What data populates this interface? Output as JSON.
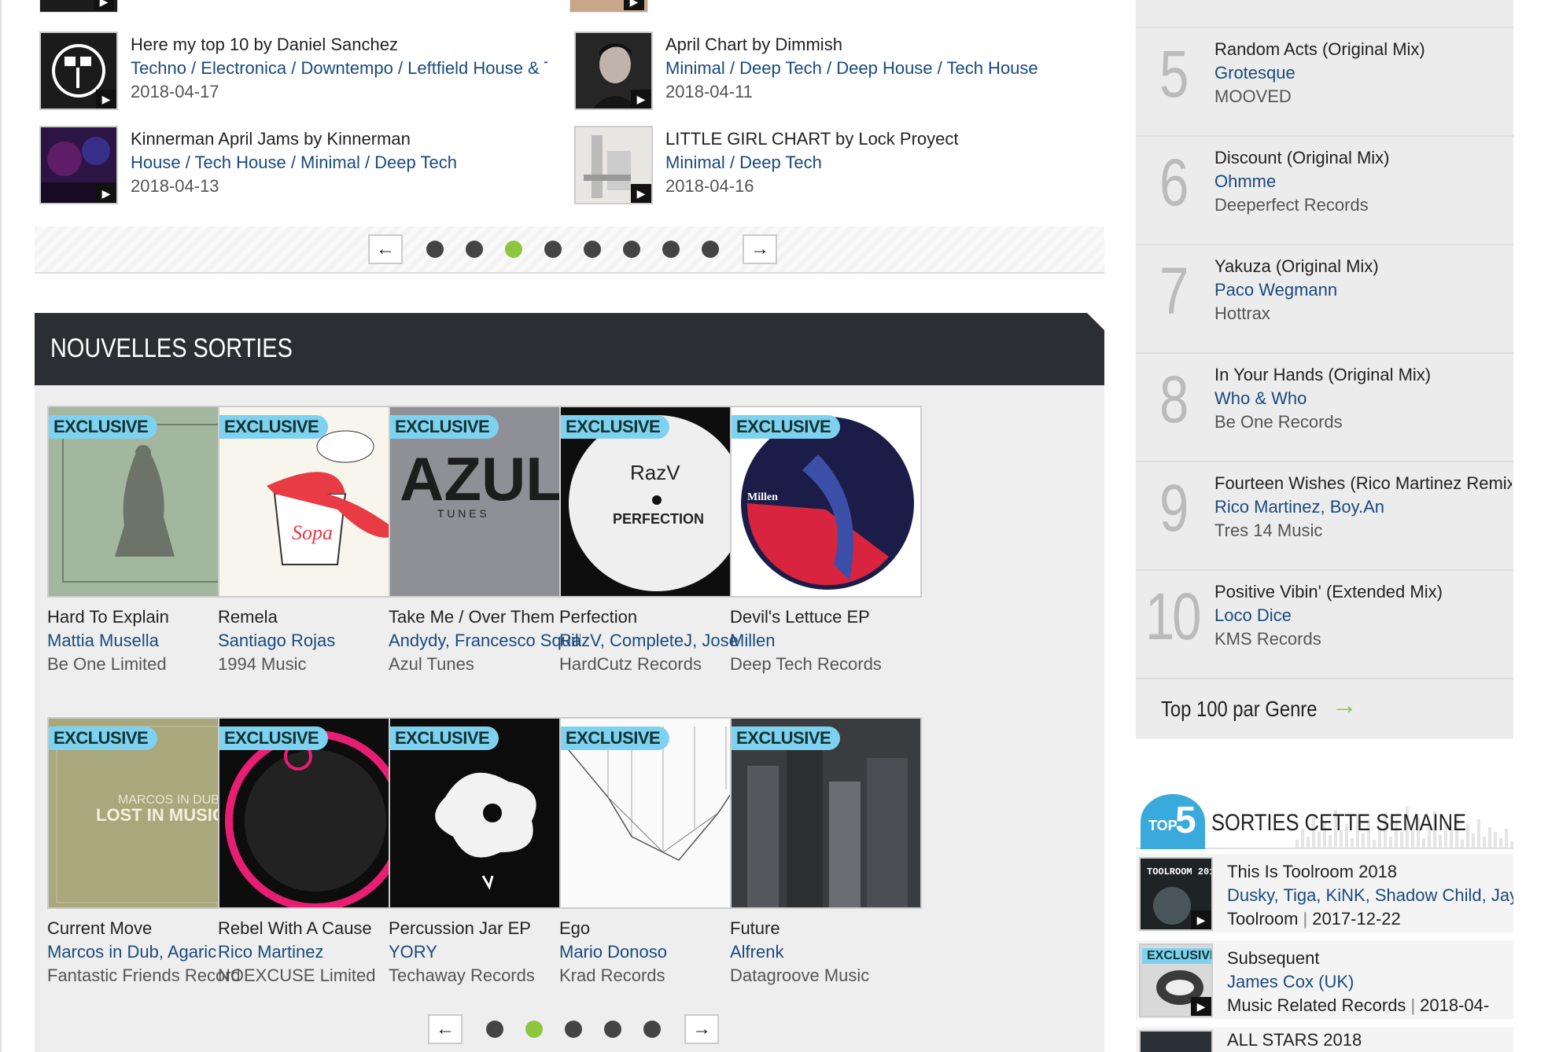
{
  "charts": [
    {
      "title": "Here my top 10 by Daniel Sanchez",
      "genres": "Techno / Electronica / Downtempo / Leftfield House & Techno",
      "date": "2018-04-17"
    },
    {
      "title": "April Chart by Dimmish",
      "genres": "Minimal / Deep Tech / Deep House / Tech House",
      "date": "2018-04-11"
    },
    {
      "title": "Kinnerman April Jams by Kinnerman",
      "genres": "House / Tech House / Minimal / Deep Tech",
      "date": "2018-04-13"
    },
    {
      "title": "LITTLE GIRL CHART by Lock Proyect",
      "genres": "Minimal / Deep Tech",
      "date": "2018-04-16"
    }
  ],
  "charts_pager": {
    "prev": "←",
    "next": "→",
    "pages": 8,
    "active": 3
  },
  "new_releases": {
    "heading": "NOUVELLES SORTIES",
    "badge": "EXCLUSIVE",
    "items": [
      {
        "title": "Hard To Explain",
        "artist": "Mattia Musella",
        "label": "Be One Limited"
      },
      {
        "title": "Remela",
        "artist": "Santiago Rojas",
        "label": "1994 Music"
      },
      {
        "title": "Take Me / Over Them",
        "artist": "Andydy, Francesco Squillante",
        "label": "Azul Tunes"
      },
      {
        "title": "Perfection",
        "artist": "RazV, CompleteJ, Jose",
        "label": "HardCutz Records"
      },
      {
        "title": "Devil's Lettuce EP",
        "artist": "Millen",
        "label": "Deep Tech Records"
      },
      {
        "title": "Current Move",
        "artist": "Marcos in Dub, Agaric",
        "label": "Fantastic Friends Records"
      },
      {
        "title": "Rebel With A Cause",
        "artist": "Rico Martinez",
        "label": "NOEXCUSE Limited"
      },
      {
        "title": "Percussion Jar EP",
        "artist": "YORY",
        "label": "Techaway Records"
      },
      {
        "title": "Ego",
        "artist": "Mario Donoso",
        "label": "Krad Records"
      },
      {
        "title": "Future",
        "artist": "Alfrenk",
        "label": "Datagroove Music"
      }
    ],
    "cover_text": {
      "azul": "AZUL",
      "azul_sub": "T U N E S",
      "razv": "RazV",
      "perfection": "PERFECTION",
      "lost": "LOST IN MUSIC",
      "marcos": "MARCOS IN DUB",
      "sopa": "Sopa",
      "millen": "Millen"
    }
  },
  "releases_pager": {
    "prev": "←",
    "next": "→",
    "pages": 5,
    "active": 2
  },
  "top10": {
    "rows": [
      {
        "num": "5",
        "title": "Random Acts (Original Mix)",
        "artist": "Grotesque",
        "label": "MOOVED"
      },
      {
        "num": "6",
        "title": "Discount (Original Mix)",
        "artist": "Ohmme",
        "label": "Deeperfect Records"
      },
      {
        "num": "7",
        "title": "Yakuza (Original Mix)",
        "artist": "Paco Wegmann",
        "label": "Hottrax"
      },
      {
        "num": "8",
        "title": "In Your Hands (Original Mix)",
        "artist": "Who & Who",
        "label": "Be One Records"
      },
      {
        "num": "9",
        "title": "Fourteen Wishes (Rico Martinez Remix)",
        "artist": "Rico Martinez, Boy.An",
        "label": "Tres 14 Music"
      },
      {
        "num": "10",
        "title": "Positive Vibin' (Extended Mix)",
        "artist": "Loco Dice",
        "label": "KMS Records"
      }
    ],
    "top100_link": "Top 100 par Genre"
  },
  "week": {
    "logo_top": "TOP",
    "logo_num": "5",
    "heading": "SORTIES CETTE SEMAINE",
    "items": [
      {
        "title": "This Is Toolroom 2018",
        "artists": "Dusky, Tiga, KiNK, Shadow Child, Jay",
        "label": "Toolroom",
        "date": "2017-12-22",
        "cover": "TOOLROOM 2018"
      },
      {
        "title": "Subsequent",
        "artists": "James Cox (UK)",
        "label": "Music Related Records",
        "date": "2018-04-",
        "badge": "EXCLUSIVE"
      },
      {
        "title": "ALL STARS 2018"
      }
    ]
  }
}
